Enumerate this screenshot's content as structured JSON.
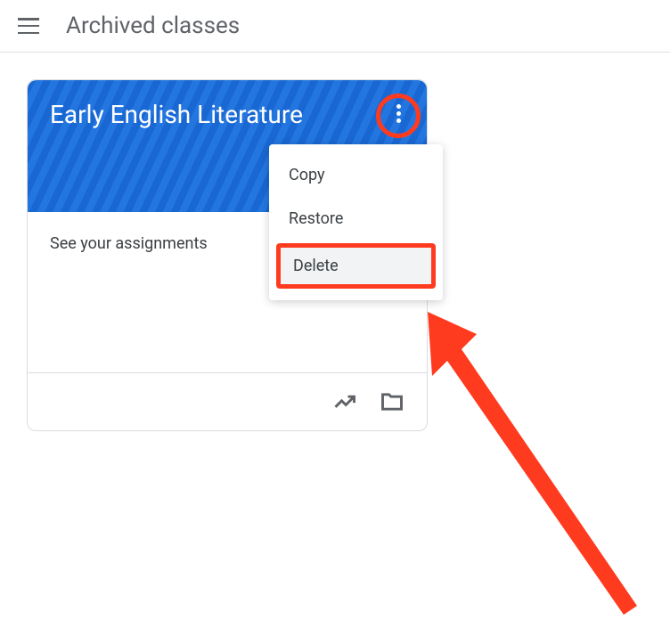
{
  "header": {
    "title": "Archived classes"
  },
  "card": {
    "title": "Early English Literature",
    "assignments": "See your assignments"
  },
  "menu": {
    "copy": "Copy",
    "restore": "Restore",
    "delete": "Delete"
  }
}
